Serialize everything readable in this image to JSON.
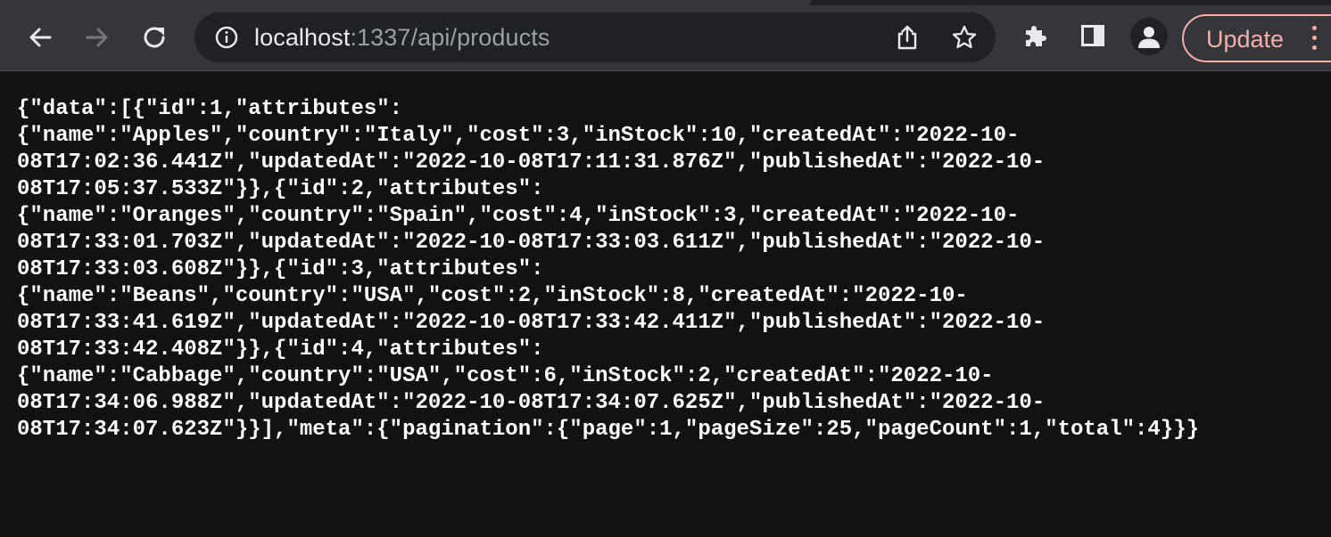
{
  "browser": {
    "url_host": "localhost",
    "url_rest": ":1337/api/products",
    "update_label": "Update",
    "accent_update": "#f6aea9",
    "icons": [
      "back-icon",
      "forward-icon",
      "reload-icon",
      "info-icon",
      "share-icon",
      "bookmark-star-icon",
      "extensions-puzzle-icon",
      "side-panel-icon",
      "profile-avatar-icon",
      "kebab-menu-icon"
    ]
  },
  "page": {
    "lines": [
      "{\"data\":[{\"id\":1,\"attributes\":",
      "{\"name\":\"Apples\",\"country\":\"Italy\",\"cost\":3,\"inStock\":10,\"createdAt\":\"2022-10-",
      "08T17:02:36.441Z\",\"updatedAt\":\"2022-10-08T17:11:31.876Z\",\"publishedAt\":\"2022-10-",
      "08T17:05:37.533Z\"}},{\"id\":2,\"attributes\":",
      "{\"name\":\"Oranges\",\"country\":\"Spain\",\"cost\":4,\"inStock\":3,\"createdAt\":\"2022-10-",
      "08T17:33:01.703Z\",\"updatedAt\":\"2022-10-08T17:33:03.611Z\",\"publishedAt\":\"2022-10-",
      "08T17:33:03.608Z\"}},{\"id\":3,\"attributes\":",
      "{\"name\":\"Beans\",\"country\":\"USA\",\"cost\":2,\"inStock\":8,\"createdAt\":\"2022-10-",
      "08T17:33:41.619Z\",\"updatedAt\":\"2022-10-08T17:33:42.411Z\",\"publishedAt\":\"2022-10-",
      "08T17:33:42.408Z\"}},{\"id\":4,\"attributes\":",
      "{\"name\":\"Cabbage\",\"country\":\"USA\",\"cost\":6,\"inStock\":2,\"createdAt\":\"2022-10-",
      "08T17:34:06.988Z\",\"updatedAt\":\"2022-10-08T17:34:07.625Z\",\"publishedAt\":\"2022-10-",
      "08T17:34:07.623Z\"}}],\"meta\":{\"pagination\":{\"page\":1,\"pageSize\":25,\"pageCount\":1,\"total\":4}}}"
    ]
  }
}
